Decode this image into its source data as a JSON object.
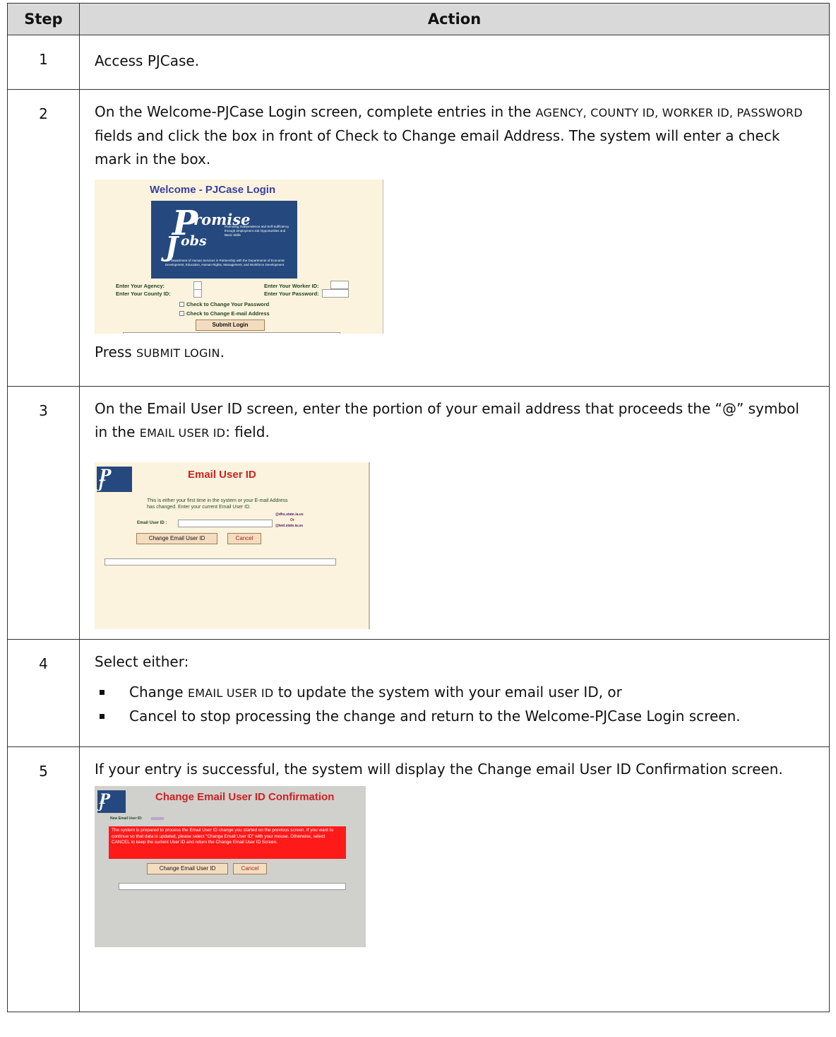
{
  "table": {
    "header_step": "Step",
    "header_action": "Action"
  },
  "rows": [
    {
      "step": "1",
      "text": "Access PJCase."
    },
    {
      "step": "2",
      "text_parts": [
        "On the Welcome-PJCase Login screen, complete entries in the ",
        "AGENCY, COUNTY ID, WORKER ID, PASSWORD",
        " fields and click the box in front of Check to Change email Address. The system will enter a check mark in the box."
      ],
      "after_parts": [
        "Press ",
        "SUBMIT LOGIN",
        "."
      ],
      "screenshot": {
        "title": "Welcome - PJCase Login",
        "logo_word1": "romise",
        "logo_word2": "obs",
        "logo_tagline": "Promoting Independence and Self-Sufficiency through employment Job Opportunities and Basic Skills",
        "logo_footer": "The Department of Human Services in Partnership with the Departments of Economic Development, Education, Human Rights, Management, and Workforce Development",
        "agency_label": "Enter Your Agency:",
        "county_label": "Enter Your County ID:",
        "worker_label": "Enter Your Worker ID:",
        "password_label": "Enter Your Password:",
        "check_password": "Check to Change Your Password",
        "check_email": "Check to Change E-mail Address",
        "submit_label": "Submit Login"
      }
    },
    {
      "step": "3",
      "text_parts": [
        "On the Email User ID screen, enter the portion of your email address that proceeds the “@” symbol in the ",
        "EMAIL USER ID",
        ": field."
      ],
      "screenshot": {
        "title": "Email User ID",
        "info": "This is either your first time in the system or your E-mail Address has changed. Enter your current Email User ID.",
        "field_label": "Email User ID :",
        "domain1": "@dhs.state.ia.us",
        "or": "Or",
        "domain2": "@iwd.state.ia.us",
        "change_btn": "Change Email User ID",
        "cancel_btn": "Cancel"
      }
    },
    {
      "step": "4",
      "text": "Select either:",
      "bullets": [
        {
          "parts": [
            "Change ",
            "EMAIL USER ID",
            " to update the system with your email user ID, or"
          ]
        },
        {
          "parts": [
            "Cancel to stop processing the change and return to the Welcome-PJCase Login screen.",
            "",
            ""
          ]
        }
      ]
    },
    {
      "step": "5",
      "text": "If your entry is successful, the system will display the Change email User ID Confirmation screen.",
      "screenshot": {
        "title": "Change Email User ID Confirmation",
        "new_label": "New Email User ID:",
        "warning": "The system is prepared to process the Email User ID change you started on the previous screen. If you want to continue so that data is updated, please select \"Change Email User ID\" with your mouse. Otherwise, select CANCEL to keep the current User ID and return the Change Email User ID Screen.",
        "change_btn": "Change Email User ID",
        "cancel_btn": "Cancel"
      }
    }
  ],
  "colors": {
    "header_bg": "#d9d9d9",
    "login_bg": "#fbf3dd",
    "confirm_bg": "#d0d0cc",
    "warning_red": "#ff1a1a",
    "logo_blue": "#25497e"
  }
}
